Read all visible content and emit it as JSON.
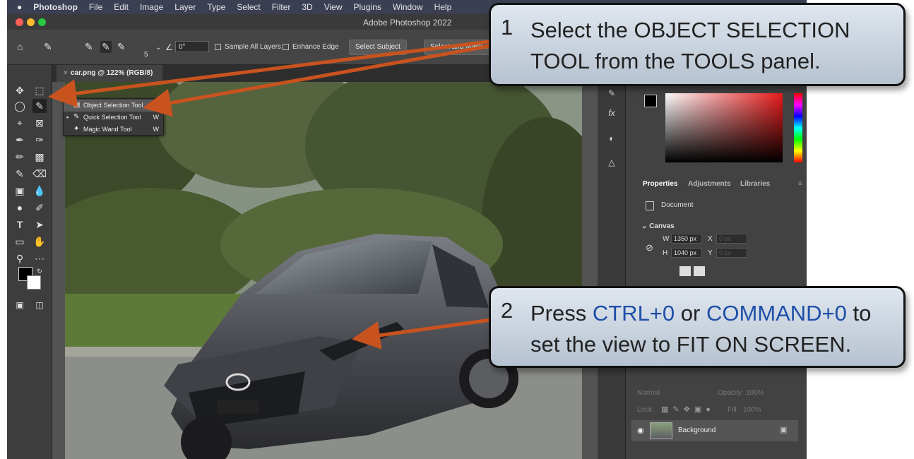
{
  "menubar": {
    "apple": "",
    "app": "Photoshop",
    "items": [
      "File",
      "Edit",
      "Image",
      "Layer",
      "Type",
      "Select",
      "Filter",
      "3D",
      "View",
      "Plugins",
      "Window",
      "Help"
    ]
  },
  "window": {
    "title": "Adobe Photoshop 2022"
  },
  "options": {
    "brush_size": "5",
    "angle": "0°",
    "sample_all_layers": "Sample All Layers",
    "enhance_edge": "Enhance Edge",
    "select_subject": "Select Subject",
    "select_mask": "Select and Mask..."
  },
  "document_tab": {
    "label": "car.png @ 122% (RGB/8)",
    "close": "×"
  },
  "flyout": {
    "items": [
      {
        "label": "Object Selection Tool",
        "shortcut": "W"
      },
      {
        "label": "Quick Selection Tool",
        "shortcut": "W"
      },
      {
        "label": "Magic Wand Tool",
        "shortcut": "W"
      }
    ]
  },
  "panel": {
    "tabs": [
      "Properties",
      "Adjustments",
      "Libraries"
    ],
    "document_label": "Document",
    "canvas_label": "Canvas",
    "w_label": "W",
    "w_value": "1350 px",
    "h_label": "H",
    "h_value": "1040 px",
    "x_label": "X",
    "x_value": "0 px",
    "y_label": "Y",
    "y_value": "0 px"
  },
  "layers": {
    "blend": "Normal",
    "opacity_label": "Opacity:",
    "opacity": "100%",
    "lock_label": "Lock:",
    "fill_label": "Fill:",
    "fill": "100%",
    "layer_name": "Background"
  },
  "callouts": {
    "c1": {
      "num": "1",
      "text": "Select the OBJECT SELECTION TOOL from the TOOLS panel."
    },
    "c2": {
      "num": "2",
      "pre": "Press ",
      "k1": "CTRL+0",
      "mid": " or ",
      "k2": "COMMAND+0",
      "post": " to set the view to FIT ON SCREEN."
    }
  },
  "colors": {
    "arrow": "#c9531f",
    "accent_text": "#1e4fa8",
    "callout_bg": "#c9d3df"
  }
}
